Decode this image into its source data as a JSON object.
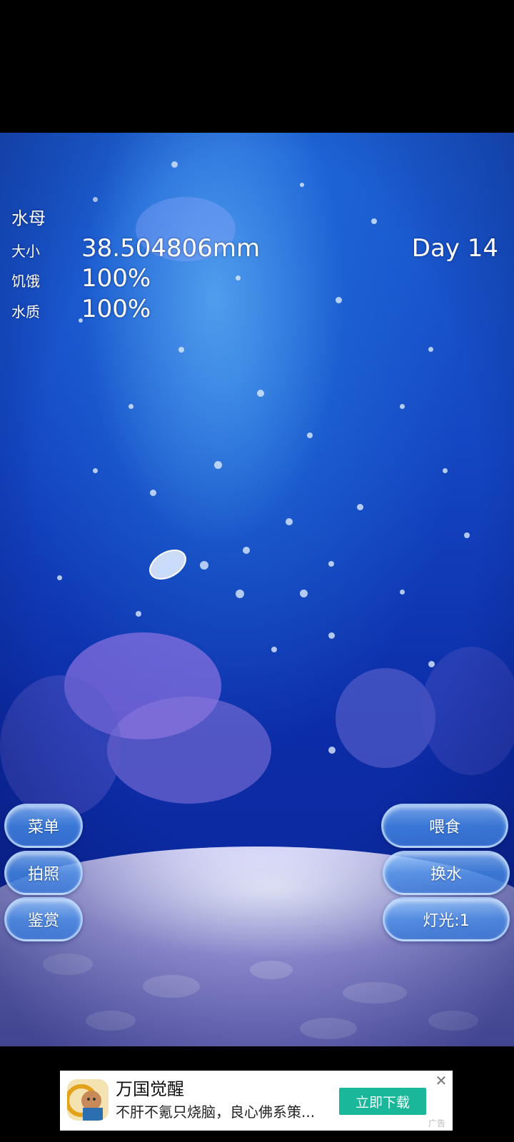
{
  "stats": {
    "title": "水母",
    "size_label": "大小",
    "size_value": "38.504806mm",
    "hunger_label": "饥饿",
    "hunger_value": "100%",
    "water_label": "水质",
    "water_value": "100%",
    "day": "Day 14"
  },
  "buttons_left": [
    "菜单",
    "拍照",
    "鉴赏"
  ],
  "buttons_right": [
    "喂食",
    "换水",
    "灯光:1"
  ],
  "ad": {
    "title": "万国觉醒",
    "description": "不肝不氪只烧脑，良心佛系策...",
    "cta": "立即下载",
    "tag": "广告",
    "close_icon": "close-icon"
  }
}
